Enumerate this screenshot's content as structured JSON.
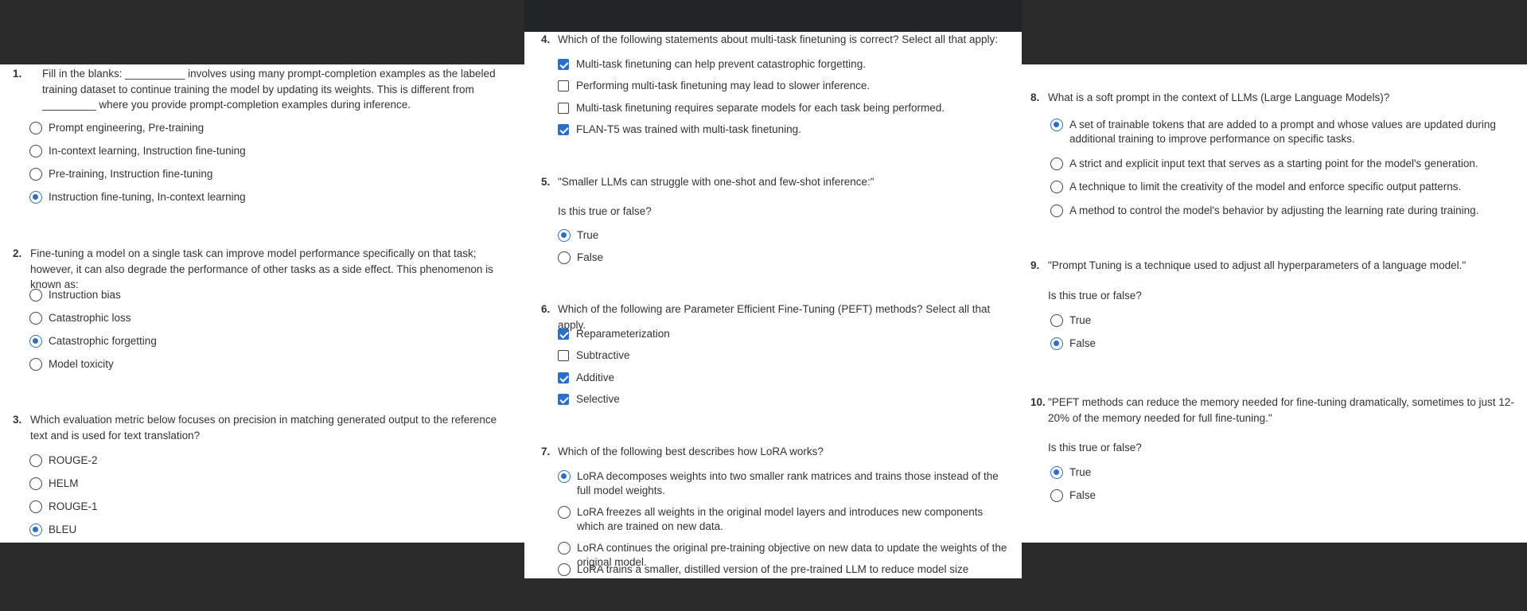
{
  "left": {
    "q1": {
      "num": "1.",
      "text": "Fill in the blanks: __________ involves using many prompt-completion examples as the labeled training dataset to continue training the model by updating its weights.  This is different from _________ where you provide prompt-completion examples during inference.",
      "options": [
        "Prompt engineering, Pre-training",
        "In-context learning, Instruction fine-tuning",
        "Pre-training, Instruction fine-tuning",
        "Instruction fine-tuning, In-context learning"
      ],
      "selected": 3
    },
    "q2": {
      "num": "2.",
      "text": "Fine-tuning a model on a single task can improve model performance specifically on that task; however, it can also degrade the performance of other tasks as a side effect.  This phenomenon is known as:",
      "options": [
        "Instruction bias",
        "Catastrophic loss",
        "Catastrophic forgetting",
        "Model toxicity"
      ],
      "selected": 2
    },
    "q3": {
      "num": "3.",
      "text": "Which evaluation metric below focuses on precision in matching generated output to the reference text and is used for text translation?",
      "options": [
        "ROUGE-2",
        "HELM",
        "ROUGE-1",
        "BLEU"
      ],
      "selected": 3
    }
  },
  "mid": {
    "q4": {
      "num": "4.",
      "text": "Which of the following statements about multi-task finetuning is correct? Select all that apply:",
      "options": [
        "Multi-task finetuning can help prevent catastrophic forgetting.",
        "Performing multi-task finetuning may lead to slower inference.",
        "Multi-task finetuning requires separate models for each task being performed.",
        "FLAN-T5 was trained with multi-task finetuning."
      ],
      "checked": [
        true,
        false,
        false,
        true
      ]
    },
    "q5": {
      "num": "5.",
      "text": "\"Smaller LLMs can struggle with one-shot and few-shot inference:\"",
      "sub": "Is this true or false?",
      "options": [
        "True",
        "False"
      ],
      "selected": 0
    },
    "q6": {
      "num": "6.",
      "text": "Which of the following are Parameter Efficient Fine-Tuning (PEFT) methods? Select all that apply.",
      "options": [
        "Reparameterization",
        "Subtractive",
        "Additive",
        "Selective"
      ],
      "checked": [
        true,
        false,
        true,
        true
      ]
    },
    "q7": {
      "num": "7.",
      "text": "Which of the following best describes how LoRA works?",
      "options": [
        "LoRA decomposes weights into two smaller rank matrices and trains those instead of the full model weights.",
        "LoRA freezes all weights in the original model layers and introduces new components which are trained on new data.",
        "LoRA continues the original pre-training objective on new data to update the weights of the original model.",
        "LoRA trains  a smaller, distilled version of the pre-trained LLM to reduce model size"
      ],
      "selected": 0
    }
  },
  "right": {
    "q8": {
      "num": "8.",
      "text": "What is a soft prompt in the context of LLMs (Large Language Models)?",
      "options": [
        "A set of trainable tokens that are added to a prompt and whose values are updated during additional training to improve performance on specific tasks.",
        "A strict and explicit input text that serves as a starting point for the model's generation.",
        "A technique to limit the creativity of the model and enforce specific output patterns.",
        "A method to control the model's behavior by adjusting the learning rate during training."
      ],
      "selected": 0
    },
    "q9": {
      "num": "9.",
      "text": "\"Prompt Tuning is a technique used to adjust all hyperparameters of a language model.\"",
      "sub": "Is this true or false?",
      "options": [
        "True",
        "False"
      ],
      "selected": 1
    },
    "q10": {
      "num": "10.",
      "text": "\"PEFT methods can reduce the memory needed for fine-tuning dramatically, sometimes to just 12-20% of the memory needed for full fine-tuning.\"",
      "sub": "Is this true or false?",
      "options": [
        "True",
        "False"
      ],
      "selected": 0
    }
  },
  "colors": {
    "accent": "#2b6fc9",
    "backdrop": "#2a2a2a",
    "topbar": "#1f2526"
  }
}
